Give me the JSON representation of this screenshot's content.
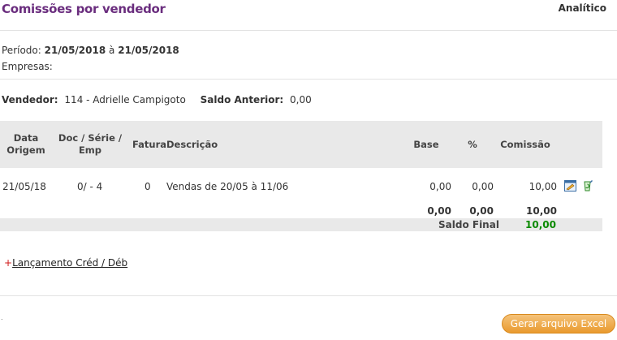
{
  "header": {
    "title": "Comissões por vendedor",
    "mode": "Analítico"
  },
  "filters": {
    "period_label": "Período:",
    "period_start": "21/05/2018",
    "period_sep": "à",
    "period_end": "21/05/2018",
    "empresas_label": "Empresas:"
  },
  "vendor": {
    "label": "Vendedor:",
    "value": "114 - Adrielle Campigoto",
    "saldo_label": "Saldo Anterior:",
    "saldo_value": "0,00"
  },
  "table": {
    "columns": {
      "data_origem": "Data Origem",
      "doc_serie_emp": "Doc / Série / Emp",
      "fatura": "Fatura",
      "descricao": "Descrição",
      "base": "Base",
      "percent": "%",
      "comissao": "Comissão"
    },
    "rows": [
      {
        "data_origem": "21/05/18",
        "doc_serie_emp": "0/ - 4",
        "fatura": "0",
        "descricao": "Vendas de 20/05 à 11/06",
        "base": "0,00",
        "percent": "0,00",
        "comissao": "10,00"
      }
    ],
    "totals": {
      "base": "0,00",
      "percent": "0,00",
      "comissao": "10,00"
    },
    "saldo_final_label": "Saldo Final",
    "saldo_final_value": "10,00"
  },
  "icons": {
    "row_action_1": "edit-window-icon",
    "row_action_2": "recycle-icon"
  },
  "actions": {
    "credit_plus": "+",
    "credit_link": "Lançamento Créd / Déb",
    "excel_button": "Gerar arquivo Excel"
  },
  "footer": {
    "dot": "."
  },
  "colors": {
    "title": "#6a2d7e",
    "saldo_final": "#0a8a00",
    "excel_button": "#e99a2e",
    "plus": "#d01818"
  }
}
